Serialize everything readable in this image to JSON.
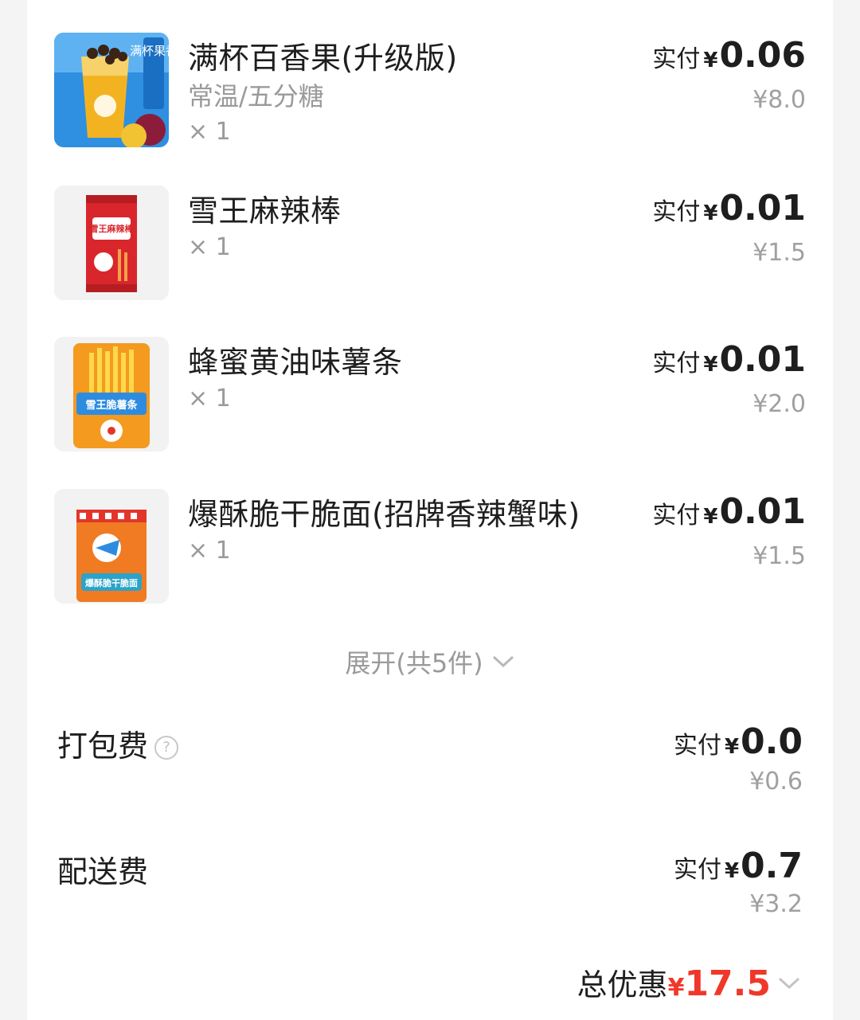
{
  "items": [
    {
      "name": "满杯百香果(升级版)",
      "spec": "常温/五分糖",
      "qty": "× 1",
      "pay_label": "实付",
      "currency": "¥",
      "pay_amount": "0.06",
      "original": "¥8.0",
      "thumb_text": "满杯果香",
      "thumb_icon": "fruit-tea-cup-icon"
    },
    {
      "name": "雪王麻辣棒",
      "qty": "× 1",
      "pay_label": "实付",
      "currency": "¥",
      "pay_amount": "0.01",
      "original": "¥1.5",
      "thumb_text": "雪王麻辣棒",
      "thumb_icon": "spicy-stick-pack-icon"
    },
    {
      "name": "蜂蜜黄油味薯条",
      "qty": "× 1",
      "pay_label": "实付",
      "currency": "¥",
      "pay_amount": "0.01",
      "original": "¥2.0",
      "thumb_text": "雪王脆薯条",
      "thumb_icon": "fries-pack-icon"
    },
    {
      "name": "爆酥脆干脆面(招牌香辣蟹味)",
      "qty": "× 1",
      "pay_label": "实付",
      "currency": "¥",
      "pay_amount": "0.01",
      "original": "¥1.5",
      "thumb_text": "爆酥脆干脆面",
      "thumb_icon": "noodle-snack-pack-icon"
    }
  ],
  "expand": {
    "label": "展开(共5件)",
    "icon": "chevron-down-icon"
  },
  "fees": [
    {
      "title": "打包费",
      "has_help": true,
      "help_glyph": "?",
      "pay_label": "实付",
      "currency": "¥",
      "pay_amount": "0.0",
      "original": "¥0.6"
    },
    {
      "title": "配送费",
      "has_help": false,
      "pay_label": "实付",
      "currency": "¥",
      "pay_amount": "0.7",
      "original": "¥3.2"
    }
  ],
  "total": {
    "label": "总优惠",
    "currency": "¥",
    "amount": "17.5",
    "icon": "chevron-down-icon"
  },
  "colors": {
    "accent_red": "#f0382a",
    "text": "#1e1e1e",
    "muted": "#9a9a9a"
  }
}
